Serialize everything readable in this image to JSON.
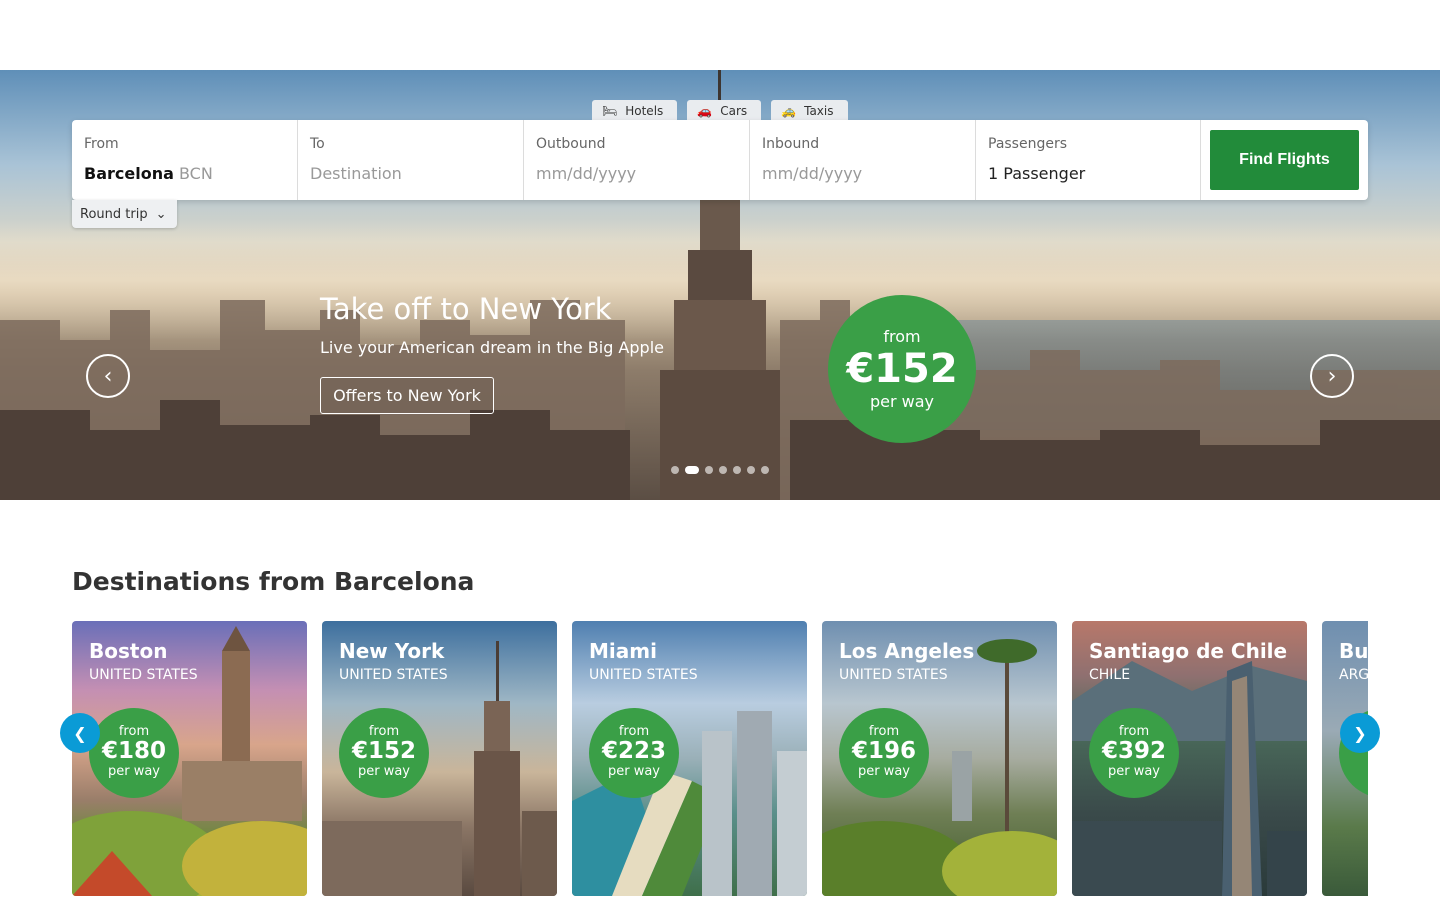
{
  "tabs": [
    {
      "label": "Hotels",
      "icon": "bed-icon"
    },
    {
      "label": "Cars",
      "icon": "car-icon"
    },
    {
      "label": "Taxis",
      "icon": "taxi-icon"
    }
  ],
  "search": {
    "from": {
      "label": "From",
      "city": "Barcelona",
      "code": "BCN"
    },
    "to": {
      "label": "To",
      "placeholder": "Destination"
    },
    "outbound": {
      "label": "Outbound",
      "placeholder": "mm/dd/yyyy"
    },
    "inbound": {
      "label": "Inbound",
      "placeholder": "mm/dd/yyyy"
    },
    "passengers": {
      "label": "Passengers",
      "value": "1 Passenger"
    },
    "find_label": "Find Flights",
    "trip_type": "Round trip"
  },
  "hero": {
    "title": "Take off to New York",
    "subtitle": "Live your American dream in the Big Apple",
    "offers_label": "Offers to New York",
    "price_from": "from",
    "price": "€152",
    "price_per": "per way",
    "slides_total": 7,
    "active_slide": 2
  },
  "destinations": {
    "title": "Destinations from Barcelona",
    "items": [
      {
        "city": "Boston",
        "country": "UNITED STATES",
        "from": "from",
        "price": "€180",
        "per": "per way"
      },
      {
        "city": "New York",
        "country": "UNITED STATES",
        "from": "from",
        "price": "€152",
        "per": "per way"
      },
      {
        "city": "Miami",
        "country": "UNITED STATES",
        "from": "from",
        "price": "€223",
        "per": "per way"
      },
      {
        "city": "Los Angeles",
        "country": "UNITED STATES",
        "from": "from",
        "price": "€196",
        "per": "per way"
      },
      {
        "city": "Santiago de Chile",
        "country": "CHILE",
        "from": "from",
        "price": "€392",
        "per": "per way"
      },
      {
        "city": "Bu",
        "country": "ARG",
        "from": "",
        "price": "€",
        "per": "p"
      }
    ]
  },
  "colors": {
    "brand_green": "#228b3a",
    "price_green": "#3a9f47",
    "carousel_blue": "#0a9bd6"
  }
}
